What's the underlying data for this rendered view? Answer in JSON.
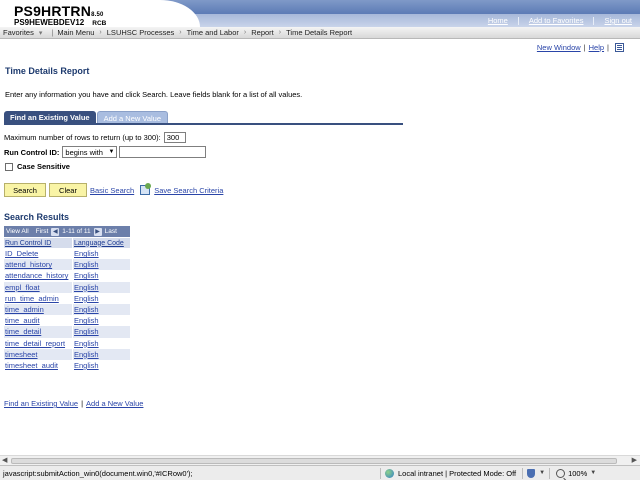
{
  "header": {
    "app_name": "PS9HRTRN",
    "app_version": "8.50",
    "db_name": "PS9HEWEBDEV12",
    "db_suffix": "RCB",
    "links": [
      "Home",
      "Add to Favorites",
      "Sign out"
    ]
  },
  "breadcrumb": {
    "items": [
      "Favorites",
      "Main Menu",
      "LSUHSC Processes",
      "Time and Labor",
      "Report",
      "Time Details Report"
    ]
  },
  "page_links": {
    "new_window": "New Window",
    "help": "Help"
  },
  "page": {
    "title": "Time Details Report",
    "instructions": "Enter any information you have and click Search. Leave fields blank for a list of all values."
  },
  "tabs": {
    "active": "Find an Existing Value",
    "inactive": "Add a New Value"
  },
  "form": {
    "max_rows_label": "Maximum number of rows to return (up to 300):",
    "max_rows_value": "300",
    "run_control_label": "Run Control ID:",
    "operator_value": "begins with",
    "run_control_value": "",
    "case_sensitive_label": "Case Sensitive",
    "case_sensitive_checked": false
  },
  "buttons": {
    "search": "Search",
    "clear": "Clear",
    "basic_search": "Basic Search",
    "save_criteria": "Save Search Criteria"
  },
  "results": {
    "title": "Search Results",
    "nav": {
      "view_all": "View All",
      "first": "First",
      "range": "1-11 of 11",
      "last": "Last"
    },
    "columns": [
      "Run Control ID",
      "Language Code"
    ],
    "rows": [
      [
        "ID_Delete",
        "English"
      ],
      [
        "attend_history",
        "English"
      ],
      [
        "attendance_history",
        "English"
      ],
      [
        "empl_float",
        "English"
      ],
      [
        "run_time_admin",
        "English"
      ],
      [
        "time_admin",
        "English"
      ],
      [
        "time_audit",
        "English"
      ],
      [
        "time_detail",
        "English"
      ],
      [
        "time_detail_report",
        "English"
      ],
      [
        "timesheet",
        "English"
      ],
      [
        "timesheet_audit",
        "English"
      ]
    ]
  },
  "bottom_links": {
    "find": "Find an Existing Value",
    "add": "Add a New Value"
  },
  "statusbar": {
    "text": "javascript:submitAction_win0(document.win0,'#ICRow0');",
    "zone": "Local intranet | Protected Mode: Off",
    "zoom": "100%"
  },
  "colors": {
    "accent": "#39507f",
    "link": "#2a45a8",
    "button": "#f9f4a6",
    "title": "#1d3a6e"
  }
}
